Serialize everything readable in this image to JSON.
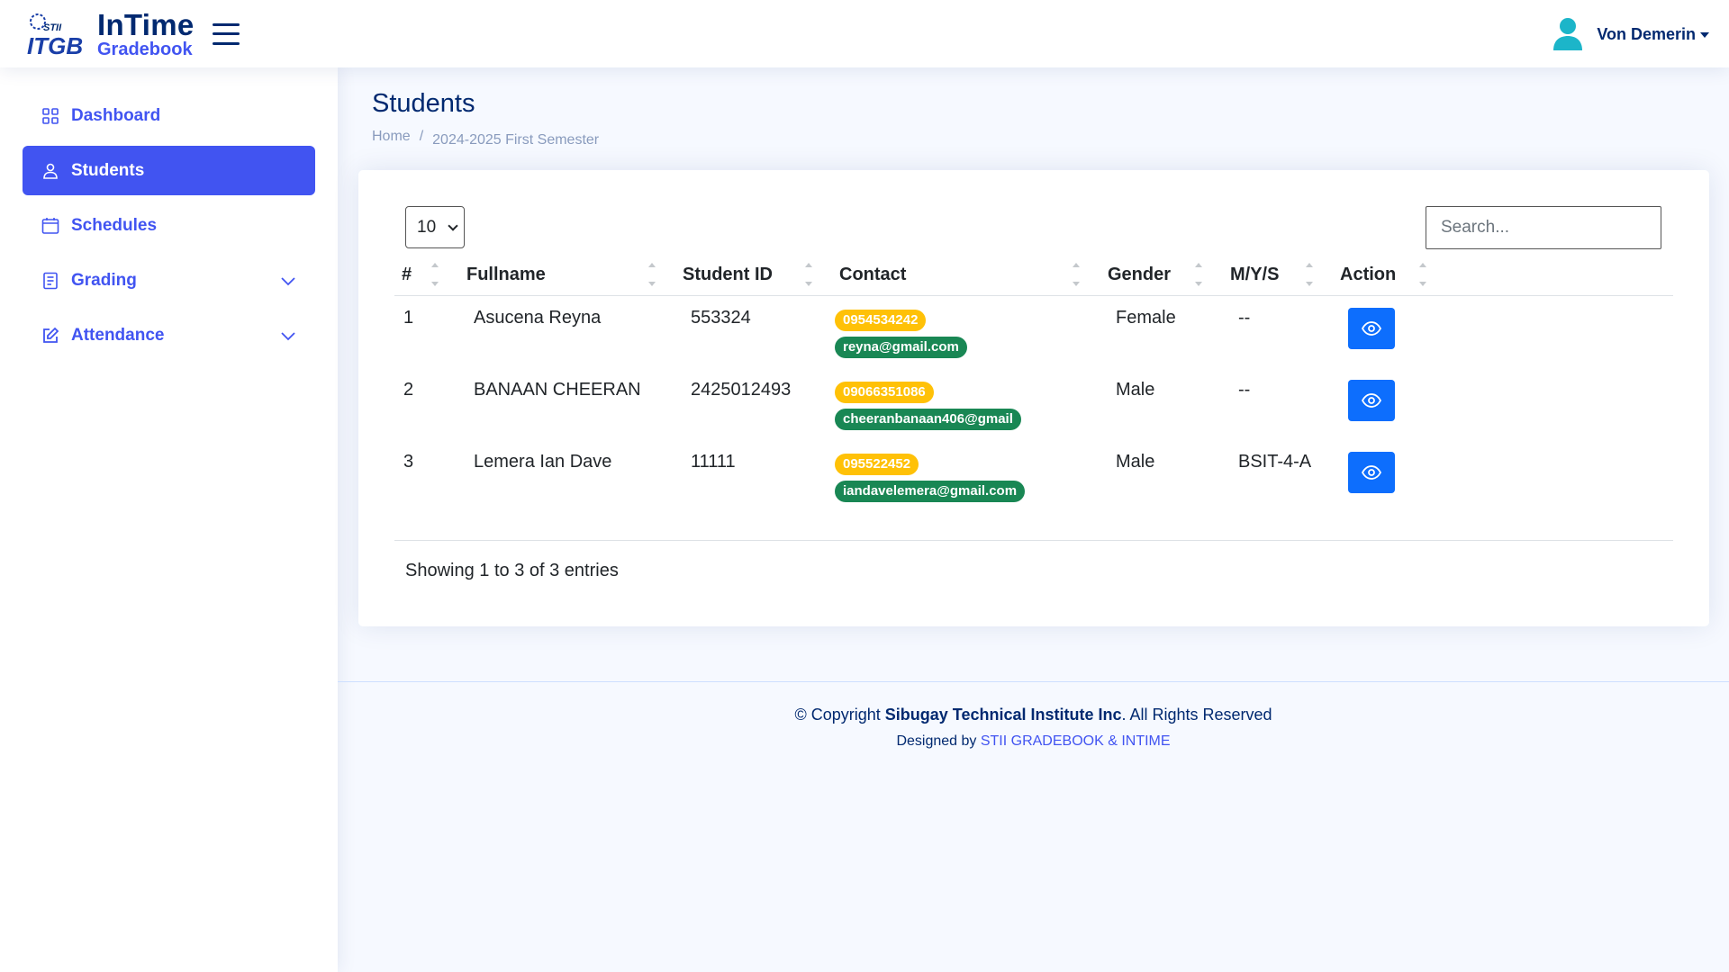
{
  "brand": {
    "title": "InTime",
    "subtitle": "Gradebook",
    "logo_text": "ITGB",
    "logo_small": "STII"
  },
  "user": {
    "name": "Von Demerin"
  },
  "sidebar": {
    "items": [
      {
        "label": "Dashboard",
        "icon": "grid-icon"
      },
      {
        "label": "Students",
        "icon": "person-icon",
        "active": true
      },
      {
        "label": "Schedules",
        "icon": "calendar-icon"
      },
      {
        "label": "Grading",
        "icon": "journal-icon",
        "expandable": true
      },
      {
        "label": "Attendance",
        "icon": "edit-icon",
        "expandable": true
      }
    ]
  },
  "page": {
    "title": "Students",
    "breadcrumb": {
      "home": "Home",
      "separator": "/",
      "current": "2024-2025 First Semester"
    }
  },
  "table_controls": {
    "page_size": "10",
    "search_placeholder": "Search..."
  },
  "table": {
    "columns": [
      "#",
      "Fullname",
      "Student ID",
      "Contact",
      "Gender",
      "M/Y/S",
      "Action"
    ],
    "rows": [
      {
        "num": "1",
        "fullname": "Asucena Reyna",
        "student_id": "553324",
        "phone": "0954534242",
        "email": "reyna@gmail.com",
        "gender": "Female",
        "mys": "--"
      },
      {
        "num": "2",
        "fullname": "BANAAN CHEERAN",
        "student_id": "2425012493",
        "phone": "09066351086",
        "email": "cheeranbanaan406@gmail",
        "gender": "Male",
        "mys": "--"
      },
      {
        "num": "3",
        "fullname": "Lemera Ian Dave",
        "student_id": "11111",
        "phone": "095522452",
        "email": "iandavelemera@gmail.com",
        "gender": "Male",
        "mys": "BSIT-4-A"
      }
    ],
    "info": "Showing 1 to 3 of 3 entries"
  },
  "footer": {
    "copyright_prefix": "© Copyright",
    "company": "Sibugay Technical Institute Inc",
    "copyright_suffix": ". All Rights Reserved",
    "designed_by": "Designed by",
    "designer": "STII GRADEBOOK & INTIME"
  },
  "colors": {
    "primary": "#4154f1",
    "navy": "#012970",
    "button": "#0d6efd",
    "phone_badge": "#ffc107",
    "email_badge": "#198754"
  }
}
